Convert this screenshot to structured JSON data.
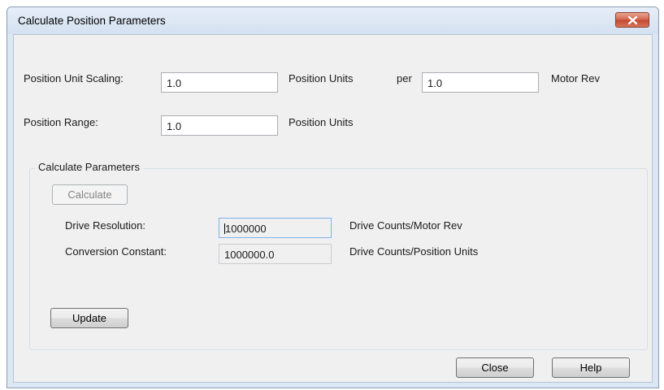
{
  "dialog": {
    "title": "Calculate Position Parameters"
  },
  "position_unit_scaling": {
    "label": "Position Unit Scaling:",
    "value": "1.0",
    "units_label": "Position Units",
    "per_label": "per",
    "per_value": "1.0",
    "per_units_label": "Motor Rev"
  },
  "position_range": {
    "label": "Position Range:",
    "value": "1.0",
    "units_label": "Position Units"
  },
  "calculate_group": {
    "title": "Calculate Parameters",
    "calculate_button": "Calculate",
    "drive_resolution": {
      "label": "Drive Resolution:",
      "value": "1000000",
      "units_label": "Drive Counts/Motor Rev"
    },
    "conversion_constant": {
      "label": "Conversion Constant:",
      "value": "1000000.0",
      "units_label": "Drive Counts/Position Units"
    },
    "update_button": "Update"
  },
  "footer": {
    "close_button": "Close",
    "help_button": "Help"
  },
  "colors": {
    "title_bar": "#dce7f4",
    "dialog_face": "#f0f0f0",
    "close_button_red": "#c9533a"
  },
  "icons": {
    "window_close": "close-icon"
  }
}
